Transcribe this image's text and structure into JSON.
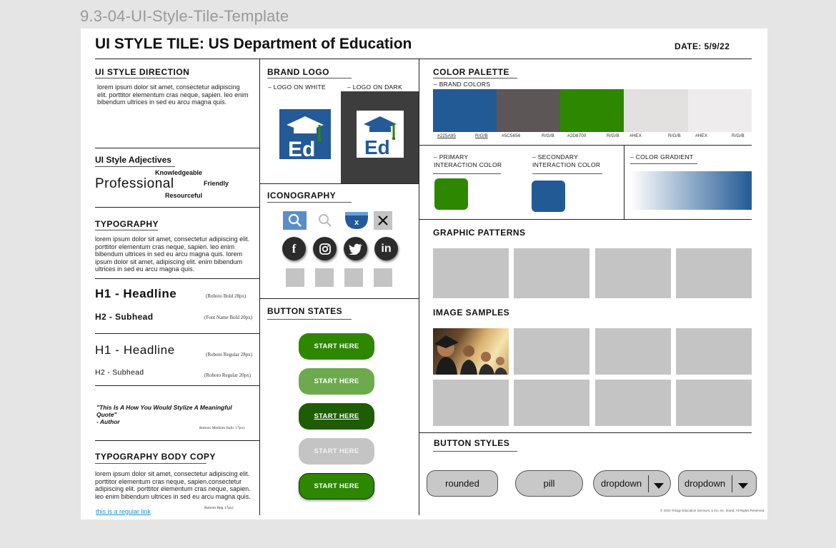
{
  "frame_label": "9.3-04-UI-Style-Tile-Template",
  "title": "UI STYLE TILE: US Department of Education",
  "date": "DATE: 5/9/22",
  "ui_style_direction": {
    "title": "UI STYLE DIRECTION",
    "body": "lorem ipsum dolor sit amet, consectetur adipiscing elit. porttitor elementum cras neque, sapien. leo enim bibendum ultrices in sed eu arcu magna quis."
  },
  "adjectives": {
    "title": "UI Style Adjectives",
    "main": "Professional",
    "words": [
      "Knowledgeable",
      "Friendly",
      "Resourceful"
    ]
  },
  "typography": {
    "title": "TYPOGRAPHY",
    "body": "lorem ipsum dolor sit amet, consectetur adipiscing elit. porttitor elementum cras neque, sapien. leo enim bibendum ultrices in sed eu arcu magna quis. lorem ipsum dolor sit amet, adipiscing elit. enim bibendum ultrices in sed eu arcu magna quis.",
    "h1_bold": "H1 - Headline",
    "h1_bold_spec": "(Roboto Bold 28px)",
    "h2_bold": "H2 - Subhead",
    "h2_bold_spec": "(Font Name Bold 20px)",
    "h1_regular": "H1 - Headline",
    "h1_regular_spec": "(Roboto Regular 28px)",
    "h2_regular": "H2 - Subhead",
    "h2_regular_spec": "(Roboto Regular 20px)",
    "quote": "\"This Is A How You Would Stylize A Meaningful Quote\"",
    "quote_author": " - Author",
    "quote_spec": "Roboto Medium Italic 17px)"
  },
  "body_copy": {
    "title": "TYPOGRAPHY BODY COPY",
    "body": "lorem ipsum dolor sit amet, consectetur adipiscing elit. porttitor elementum cras neque, sapien.consectetur adipiscing elit. porttitor elementum cras neque, sapien. leo enim bibendum ultrices in sed eu arcu magna quis.",
    "link": "this is a regular link",
    "spec": "Roboto Reg 17px)"
  },
  "brand_logo": {
    "title": "BRAND LOGO",
    "on_white": "– LOGO ON WHITE",
    "on_dark": "– LOGO ON DARK",
    "logo_text": "Ed"
  },
  "iconography": {
    "title": "ICONOGRAPHY",
    "badge_x": "x",
    "social": [
      "f",
      "ig",
      "tw",
      "in"
    ]
  },
  "button_states": {
    "title": "BUTTON STATES",
    "labels": [
      "START HERE",
      "START HERE",
      "START HERE",
      "START HERE",
      "START HERE"
    ]
  },
  "color_palette": {
    "title": "COLOR PALETTE",
    "brand_label": "– BRAND COLORS",
    "swatches": [
      {
        "color": "#225A95",
        "hex": "#225A95",
        "rgb": "R/G/B"
      },
      {
        "color": "#5C5656",
        "hex": "#5C5656",
        "rgb": "R/G/B"
      },
      {
        "color": "#2D8700",
        "hex": "#2D8700",
        "rgb": "R/G/B"
      },
      {
        "color": "#e2e1e0",
        "hex": "#HEX",
        "rgb": "R/G/B"
      },
      {
        "color": "#eeeced",
        "hex": "#HEX",
        "rgb": "R/G/B"
      }
    ],
    "primary_label": "– PRIMARY INTERACTION COLOR",
    "primary_color": "#2D8700",
    "secondary_label": "– SECONDARY INTERACTION COLOR",
    "secondary_color": "#225A95",
    "gradient_label": "– COLOR GRADIENT"
  },
  "graphic_patterns": {
    "title": "GRAPHIC PATTERNS"
  },
  "image_samples": {
    "title": "IMAGE SAMPLES"
  },
  "button_styles": {
    "title": "BUTTON STYLES",
    "rounded": "rounded",
    "pill": "pill",
    "dropdown1": "dropdown",
    "dropdown2": "dropdown"
  },
  "footer": "© 2020 Trilogy Education Services, a 2U, Inc. brand. All Rights Reserved."
}
